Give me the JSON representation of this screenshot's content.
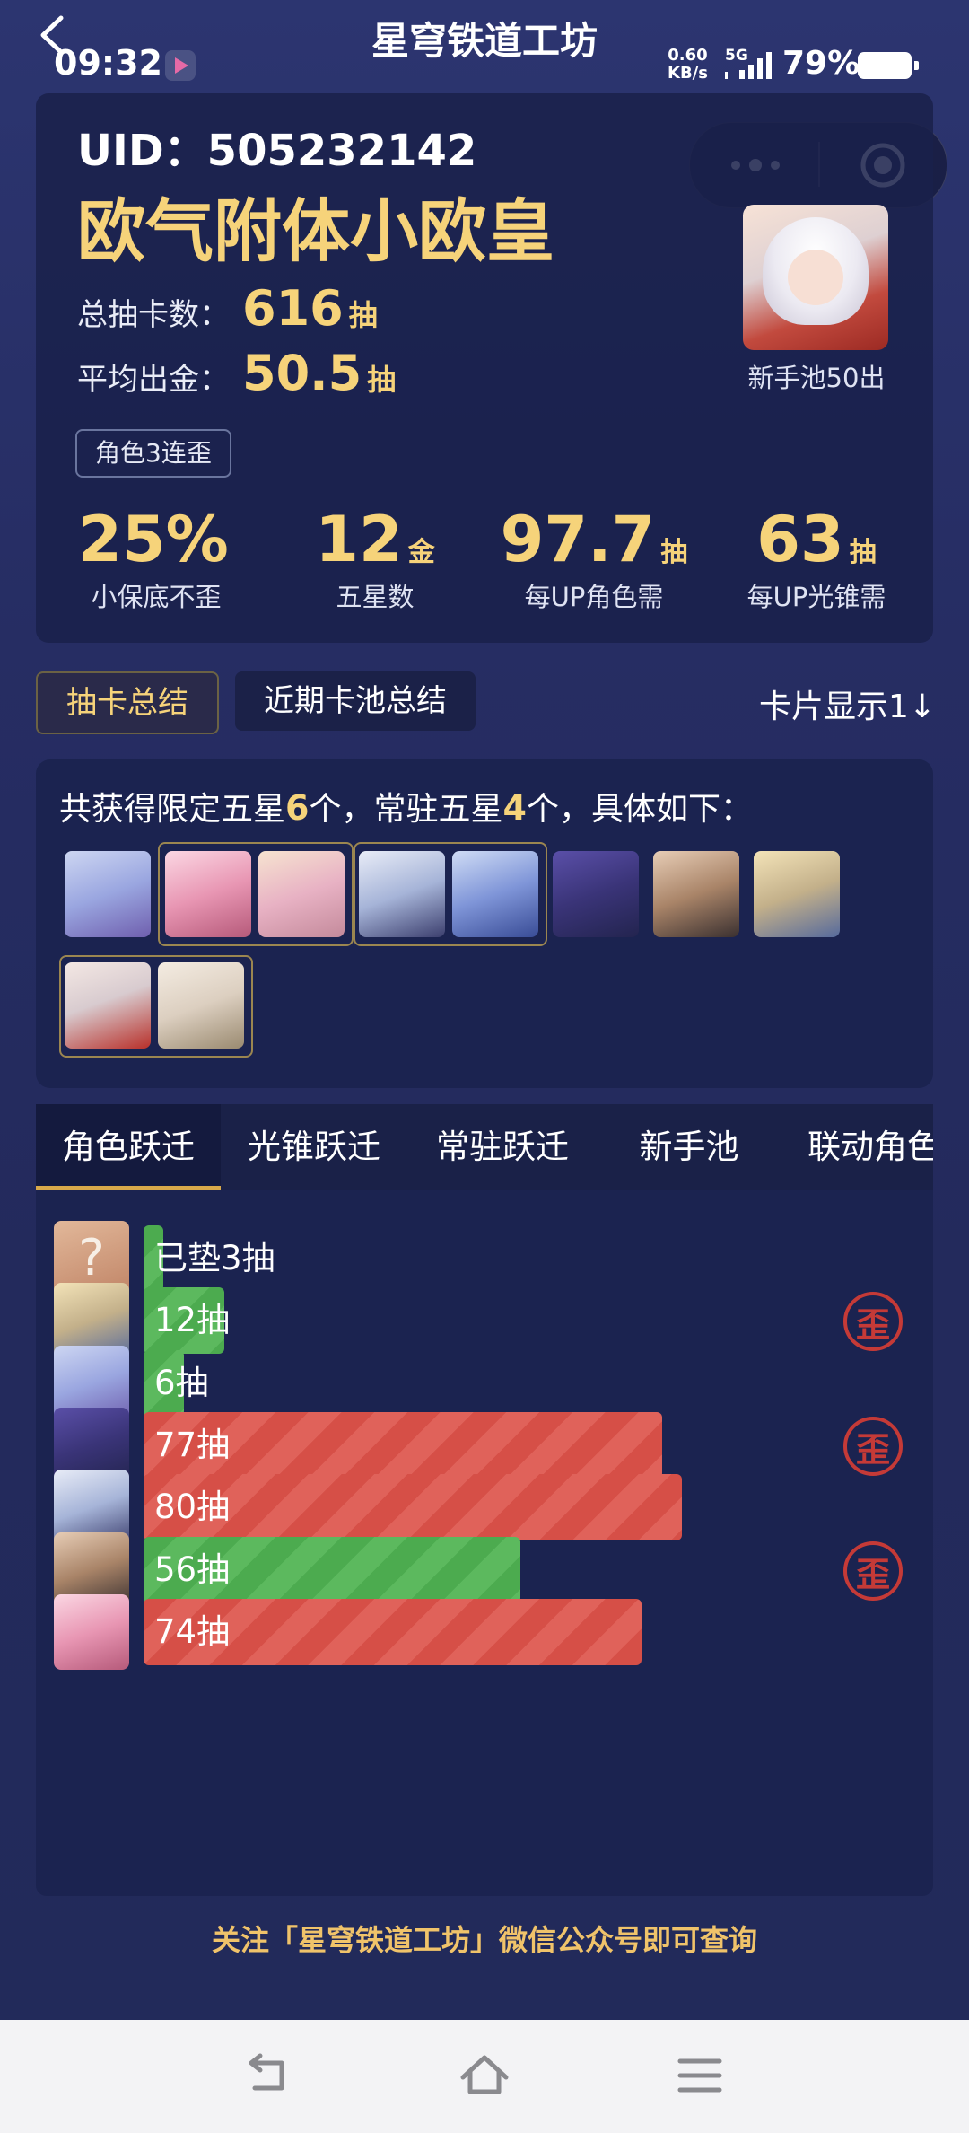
{
  "status_bar": {
    "time": "09:32",
    "net_speed_value": "0.60",
    "net_speed_unit": "KB/s",
    "network": "5G",
    "battery": "79%"
  },
  "header": {
    "title": "星穹铁道工坊"
  },
  "profile": {
    "uid": "UID：505232142",
    "title": "欧气附体小欧皇",
    "total_pulls_label": "总抽卡数：",
    "total_pulls_value": "616",
    "average_gold_label": "平均出金：",
    "average_gold_value": "50.5",
    "pull_unit": "抽",
    "tag": "角色3连歪",
    "featured_label": "新手池50出"
  },
  "stats": [
    {
      "value": "25%",
      "unit": "",
      "label": "小保底不歪"
    },
    {
      "value": "12",
      "unit": "金",
      "label": "五星数"
    },
    {
      "value": "97.7",
      "unit": "抽",
      "label": "每UP角色需"
    },
    {
      "value": "63",
      "unit": "抽",
      "label": "每UP光锥需"
    }
  ],
  "mode_tabs": {
    "active": "抽卡总结",
    "inactive": "近期卡池总结",
    "card_display": "卡片显示1↓"
  },
  "five_star": {
    "prefix": "共获得限定五星",
    "limited_count": "6",
    "middle": "个，常驻五星",
    "standard_count": "4",
    "suffix": "个，具体如下："
  },
  "history_tabs": [
    "角色跃迁",
    "光锥跃迁",
    "常驻跃迁",
    "新手池",
    "联动角色"
  ],
  "history": [
    {
      "label": "已垫3抽",
      "pulls": 3,
      "status": "pending"
    },
    {
      "label": "12抽",
      "pulls": 12,
      "status": "good",
      "crooked": true
    },
    {
      "label": "6抽",
      "pulls": 6,
      "status": "good",
      "crooked": false
    },
    {
      "label": "77抽",
      "pulls": 77,
      "status": "bad",
      "crooked": true
    },
    {
      "label": "80抽",
      "pulls": 80,
      "status": "bad",
      "crooked": false
    },
    {
      "label": "56抽",
      "pulls": 56,
      "status": "good",
      "crooked": true
    },
    {
      "label": "74抽",
      "pulls": 74,
      "status": "bad",
      "crooked": false
    }
  ],
  "crooked_mark": "歪",
  "unknown_mark": "?",
  "footer": "关注「星穹铁道工坊」微信公众号即可查询",
  "colors": {
    "gold": "#f6d37a",
    "good": "#4cab4f",
    "bad": "#d64f47",
    "crooked": "#c53a37",
    "tab_accent": "#d8a94a"
  }
}
